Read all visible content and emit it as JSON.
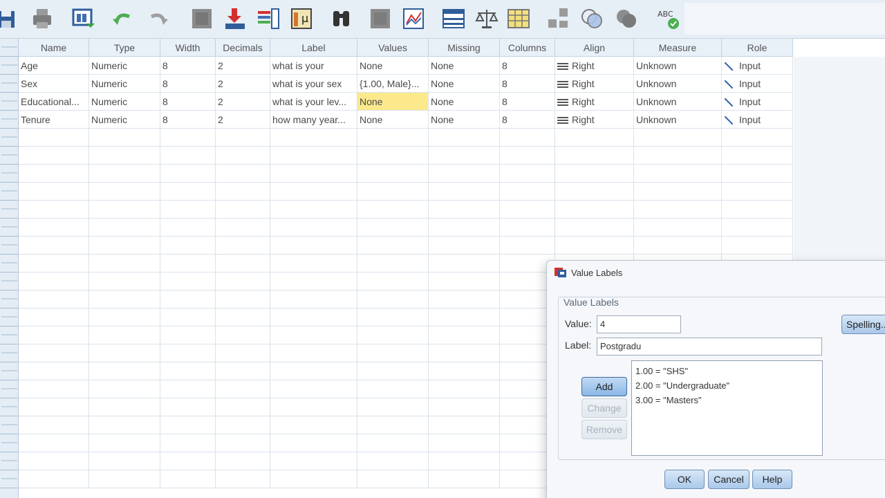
{
  "toolbar": {
    "icons": [
      "save-icon",
      "print-icon",
      "dialog-recall-icon",
      "undo-icon",
      "redo-icon",
      "goto-case-icon",
      "goto-variable-icon",
      "variables-icon",
      "run-descriptives-icon",
      "find-icon",
      "insert-cases-icon",
      "insert-variable-icon",
      "split-file-icon",
      "weight-cases-icon",
      "select-cases-icon",
      "value-labels-icon",
      "use-sets-icon",
      "show-all-variables-icon",
      "spell-check-icon"
    ],
    "spell_label": "ABC"
  },
  "grid": {
    "columns": [
      "Name",
      "Type",
      "Width",
      "Decimals",
      "Label",
      "Values",
      "Missing",
      "Columns",
      "Align",
      "Measure",
      "Role"
    ],
    "rows": [
      {
        "name": "Age",
        "type": "Numeric",
        "width": "8",
        "decimals": "2",
        "label": "what is your",
        "values": "None",
        "missing": "None",
        "columns": "8",
        "align": "Right",
        "measure": "Unknown",
        "role": "Input"
      },
      {
        "name": "Sex",
        "type": "Numeric",
        "width": "8",
        "decimals": "2",
        "label": "what is your sex",
        "values": "{1.00, Male}...",
        "missing": "None",
        "columns": "8",
        "align": "Right",
        "measure": "Unknown",
        "role": "Input"
      },
      {
        "name": "Educational...",
        "type": "Numeric",
        "width": "8",
        "decimals": "2",
        "label": "what is your lev...",
        "values": "None",
        "missing": "None",
        "columns": "8",
        "align": "Right",
        "measure": "Unknown",
        "role": "Input"
      },
      {
        "name": "Tenure",
        "type": "Numeric",
        "width": "8",
        "decimals": "2",
        "label": "how many year...",
        "values": "None",
        "missing": "None",
        "columns": "8",
        "align": "Right",
        "measure": "Unknown",
        "role": "Input"
      }
    ],
    "highlight": {
      "row": 2,
      "col": "values",
      "color": "#fbe98c"
    }
  },
  "dialog": {
    "title": "Value Labels",
    "group_label": "Value Labels",
    "value_label": "Value:",
    "value": "4",
    "label_label": "Label:",
    "label_value": "Postgradu",
    "list": [
      "1.00 = \"SHS\"",
      "2.00 = \"Undergraduate\"",
      "3.00 = \"Masters\""
    ],
    "buttons": {
      "add": "Add",
      "change": "Change",
      "remove": "Remove",
      "spelling": "Spelling...",
      "ok": "OK",
      "cancel": "Cancel",
      "help": "Help"
    }
  }
}
